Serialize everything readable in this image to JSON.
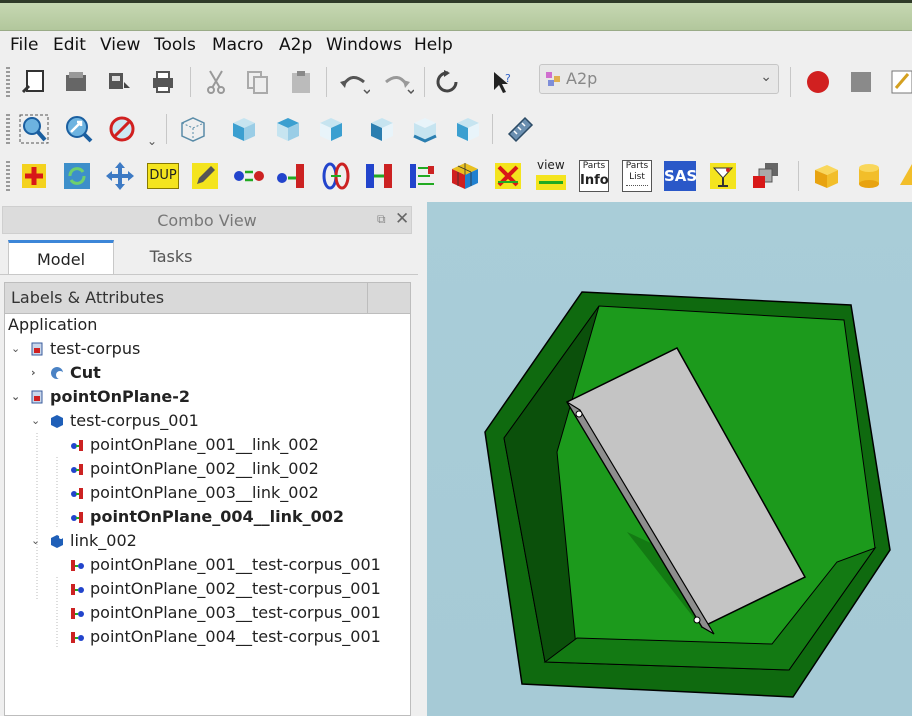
{
  "menu": {
    "items": [
      "File",
      "Edit",
      "View",
      "Tools",
      "Macro",
      "A2p",
      "Windows",
      "Help"
    ]
  },
  "toolbar": {
    "workbench_selected": "A2p",
    "dup_label": "DUP",
    "view_label": "view",
    "parts_info_top": "Parts",
    "parts_info_bottom": "Info",
    "parts_list_top": "Parts",
    "parts_list_bottom": "List",
    "sas_label": "SAS"
  },
  "combo": {
    "title": "Combo View",
    "tabs": [
      "Model",
      "Tasks"
    ],
    "tree_header": "Labels & Attributes",
    "root": "Application",
    "rows": [
      {
        "label": "test-corpus",
        "level": 1,
        "expanded": true,
        "bold": false
      },
      {
        "label": "Cut",
        "level": 2,
        "expanded": false,
        "bold": true
      },
      {
        "label": "pointOnPlane-2",
        "level": 1,
        "expanded": true,
        "bold": true
      },
      {
        "label": "test-corpus_001",
        "level": 2,
        "expanded": true,
        "bold": false
      },
      {
        "label": "pointOnPlane_001__link_002",
        "level": 3,
        "bold": false
      },
      {
        "label": "pointOnPlane_002__link_002",
        "level": 3,
        "bold": false
      },
      {
        "label": "pointOnPlane_003__link_002",
        "level": 3,
        "bold": false
      },
      {
        "label": "pointOnPlane_004__link_002",
        "level": 3,
        "bold": true
      },
      {
        "label": "link_002",
        "level": 2,
        "expanded": true,
        "bold": false
      },
      {
        "label": "pointOnPlane_001__test-corpus_001",
        "level": 3,
        "bold": false
      },
      {
        "label": "pointOnPlane_002__test-corpus_001",
        "level": 3,
        "bold": false
      },
      {
        "label": "pointOnPlane_003__test-corpus_001",
        "level": 3,
        "bold": false
      },
      {
        "label": "pointOnPlane_004__test-corpus_001",
        "level": 3,
        "bold": false
      }
    ]
  },
  "colors": {
    "corpus_green": "#1fa01f",
    "corpus_dark": "#0d5a0d",
    "plate_gray": "#c4c4c4",
    "viewport_bg": "#a9cdd8"
  }
}
